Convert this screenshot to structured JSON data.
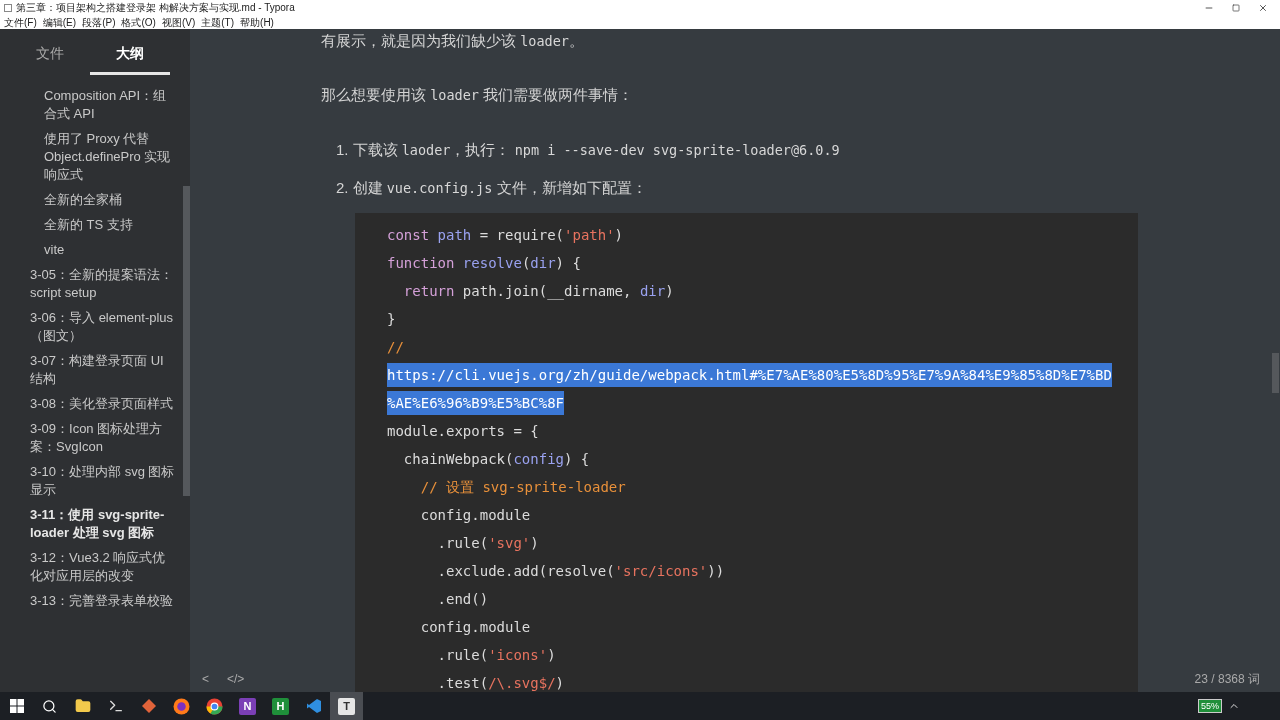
{
  "window": {
    "title": "第三章：项目架构之搭建登录架 构解决方案与实现.md - Typora"
  },
  "menu": [
    "文件(F)",
    "编辑(E)",
    "段落(P)",
    "格式(O)",
    "视图(V)",
    "主题(T)",
    "帮助(H)"
  ],
  "sidebar": {
    "tabs": [
      {
        "label": "文件",
        "selected": false
      },
      {
        "label": "大纲",
        "selected": true
      }
    ],
    "outline": [
      {
        "children": [
          {
            "label": "Composition API：组合式 API",
            "selected": false
          },
          {
            "label": "使用了 Proxy 代替 Object.definePro 实现响应式",
            "selected": false
          },
          {
            "label": "全新的全家桶",
            "selected": false
          },
          {
            "label": "全新的 TS 支持",
            "selected": false
          },
          {
            "label": "vite",
            "selected": false
          }
        ]
      },
      {
        "label": "3-05：全新的提案语法：script setup",
        "selected": false
      },
      {
        "label": "3-06：导入 element-plus （图文）",
        "selected": false
      },
      {
        "label": "3-07：构建登录页面 UI 结构",
        "selected": false
      },
      {
        "label": "3-08：美化登录页面样式",
        "selected": false
      },
      {
        "label": "3-09：Icon 图标处理方案：SvgIcon",
        "selected": false
      },
      {
        "label": "3-10：处理内部 svg 图标显示",
        "selected": false
      },
      {
        "label": "3-11：使用 svg-sprite-loader 处理 svg 图标",
        "selected": true
      },
      {
        "label": "3-12：Vue3.2 响应式优化对应用层的改变",
        "selected": false
      },
      {
        "label": "3-13：完善登录表单校验",
        "selected": false
      }
    ]
  },
  "document": {
    "blocks": [
      {
        "kind": "para",
        "segments": [
          {
            "kind": "text",
            "text": "有展示，就是因为我们缺少该 "
          },
          {
            "kind": "code",
            "text": "loader"
          },
          {
            "kind": "text",
            "text": "。"
          }
        ]
      },
      {
        "kind": "para",
        "segments": [
          {
            "kind": "text",
            "text": "那么想要使用该 "
          },
          {
            "kind": "code",
            "text": "loader"
          },
          {
            "kind": "text",
            "text": " 我们需要做两件事情："
          }
        ]
      },
      {
        "kind": "item",
        "number": "1.",
        "segments": [
          {
            "kind": "text",
            "text": "下载该 "
          },
          {
            "kind": "code",
            "text": "laoder"
          },
          {
            "kind": "text",
            "text": "，执行： "
          },
          {
            "kind": "code",
            "text": "npm i --save-dev svg-sprite-loader@6.0.9"
          }
        ]
      },
      {
        "kind": "item",
        "number": "2.",
        "segments": [
          {
            "kind": "text",
            "text": "创建 "
          },
          {
            "kind": "code",
            "text": "vue.config.js"
          },
          {
            "kind": "text",
            "text": " 文件，新增如下配置："
          }
        ]
      }
    ],
    "code": [
      {
        "selected": false,
        "tokens": [
          {
            "kind": "keyword",
            "text": "const"
          },
          {
            "kind": "variable",
            "text": " path"
          },
          {
            "kind": "plain",
            "text": " = require("
          },
          {
            "kind": "string",
            "text": "'path'"
          },
          {
            "kind": "plain",
            "text": ")"
          }
        ]
      },
      {
        "selected": false,
        "tokens": [
          {
            "kind": "keyword",
            "text": "function"
          },
          {
            "kind": "variable",
            "text": " resolve"
          },
          {
            "kind": "plain",
            "text": "("
          },
          {
            "kind": "variable",
            "text": "dir"
          },
          {
            "kind": "plain",
            "text": ") {"
          }
        ]
      },
      {
        "selected": false,
        "tokens": [
          {
            "kind": "keyword",
            "text": "  return"
          },
          {
            "kind": "plain",
            "text": " path.join(__dirname, "
          },
          {
            "kind": "variable",
            "text": "dir"
          },
          {
            "kind": "plain",
            "text": ")"
          }
        ]
      },
      {
        "selected": false,
        "tokens": [
          {
            "kind": "plain",
            "text": "}"
          }
        ]
      },
      {
        "selected": false,
        "tokens": [
          {
            "kind": "comment",
            "text": "//"
          }
        ]
      },
      {
        "selected": true,
        "tokens": [
          {
            "kind": "plain",
            "text": "https://cli.vuejs.org/zh/guide/webpack.html#%E7%AE%80%E5%8D%95%E7%9A%84%E9%85%8D%E7%BD"
          }
        ]
      },
      {
        "selected": true,
        "tokens": [
          {
            "kind": "plain",
            "text": "%AE%E6%96%B9%E5%BC%8F"
          }
        ]
      },
      {
        "selected": false,
        "tokens": [
          {
            "kind": "plain",
            "text": "module.exports = {"
          }
        ]
      },
      {
        "selected": false,
        "tokens": [
          {
            "kind": "plain",
            "text": "  chainWebpack("
          },
          {
            "kind": "variable",
            "text": "config"
          },
          {
            "kind": "plain",
            "text": ") {"
          }
        ]
      },
      {
        "selected": false,
        "tokens": [
          {
            "kind": "comment",
            "text": "    // 设置 svg-sprite-loader"
          }
        ]
      },
      {
        "selected": false,
        "tokens": [
          {
            "kind": "plain",
            "text": "    config.module"
          }
        ]
      },
      {
        "selected": false,
        "tokens": [
          {
            "kind": "plain",
            "text": "      .rule("
          },
          {
            "kind": "string",
            "text": "'svg'"
          },
          {
            "kind": "plain",
            "text": ")"
          }
        ]
      },
      {
        "selected": false,
        "tokens": [
          {
            "kind": "plain",
            "text": "      .exclude.add(resolve("
          },
          {
            "kind": "string",
            "text": "'src/icons'"
          },
          {
            "kind": "plain",
            "text": "))"
          }
        ]
      },
      {
        "selected": false,
        "tokens": [
          {
            "kind": "plain",
            "text": "      .end()"
          }
        ]
      },
      {
        "selected": false,
        "tokens": [
          {
            "kind": "plain",
            "text": "    config.module"
          }
        ]
      },
      {
        "selected": false,
        "tokens": [
          {
            "kind": "plain",
            "text": "      .rule("
          },
          {
            "kind": "string",
            "text": "'icons'"
          },
          {
            "kind": "plain",
            "text": ")"
          }
        ]
      },
      {
        "selected": false,
        "tokens": [
          {
            "kind": "plain",
            "text": "      .test("
          },
          {
            "kind": "string",
            "text": "/\\.svg$/"
          },
          {
            "kind": "plain",
            "text": ")"
          }
        ]
      }
    ]
  },
  "footer": {
    "prev": "<",
    "source": "</>",
    "word_count": "23 / 8368 词"
  },
  "taskbar": {
    "apps": [
      {
        "kind": "start",
        "selected": false
      },
      {
        "kind": "search",
        "selected": false
      },
      {
        "kind": "folder",
        "selected": false
      },
      {
        "kind": "terminal",
        "selected": false
      },
      {
        "kind": "git",
        "selected": false
      },
      {
        "kind": "firefox",
        "selected": false
      },
      {
        "kind": "chrome",
        "selected": false
      },
      {
        "kind": "note",
        "label": "N",
        "selected": false
      },
      {
        "kind": "letter",
        "label": "H",
        "selected": false
      },
      {
        "kind": "vscode",
        "selected": false
      },
      {
        "kind": "typora",
        "label": "T",
        "selected": true
      }
    ],
    "battery": "55%"
  }
}
